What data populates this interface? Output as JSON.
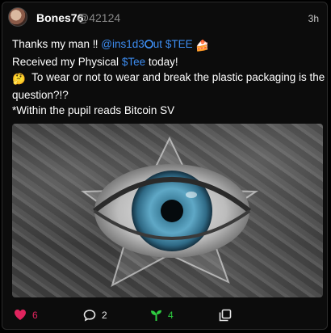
{
  "post": {
    "author": {
      "username": "Bones76",
      "handle": "@42124",
      "avatar_icon": "avatar-image"
    },
    "timestamp": "3h",
    "text": {
      "line1_prefix": "Thanks my man ‼",
      "line1_mention": "@ins1d3",
      "line1_mention_suffix": "ut",
      "line1_ticker": "$TEE",
      "line1_emoji": "🍰",
      "line2_prefix": "Received my Physical",
      "line2_ticker": "$Tee",
      "line2_suffix": "today!",
      "line3_emoji": "🤔",
      "line3_text": "To wear or not to wear and break the plastic packaging is the question?!?",
      "line4": "*Within the pupil reads Bitcoin SV"
    },
    "media": {
      "description_icon": "photo-image"
    },
    "actions": {
      "likes": "6",
      "comments": "2",
      "tips": "4"
    },
    "colors": {
      "accent_link": "#3d8cf0",
      "like": "#e0245e",
      "tip": "#2ecc40",
      "background": "#0c0c0c"
    }
  }
}
